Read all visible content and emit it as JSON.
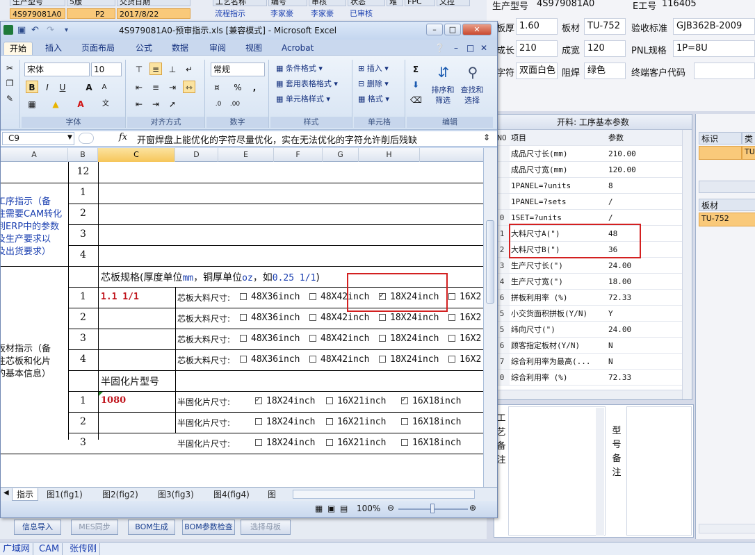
{
  "background_app": {
    "top_table": {
      "headers": [
        "生产型号",
        "5版",
        "交货日期"
      ],
      "row": {
        "model": "4S979081A0",
        "ver": "P2",
        "date": "2017/8/22"
      },
      "flow_headers": [
        "工艺名称",
        "编号",
        "审核",
        "状态",
        "难",
        "FPC",
        "文控"
      ],
      "flow_row": {
        "name": "流程指示",
        "no": "李家豪",
        "audit": "李家豪",
        "state": "已审核"
      }
    },
    "right_header": {
      "model_label": "生产型号",
      "model_value": "4S979081A0",
      "eno_label": "E工号",
      "eno_value": "116405",
      "thick_label": "板厚",
      "thick_value": "1.60",
      "mat_label": "板材",
      "mat_value": "TU-752",
      "std_label": "验收标准",
      "std_value": "GJB362B-2009",
      "len_label": "成长",
      "len_value": "210",
      "wid_label": "成宽",
      "wid_value": "120",
      "pnl_label": "PNL规格",
      "pnl_value": "1P=8U",
      "char_label": "字符",
      "char_value": "双面白色",
      "mask_label": "阻焊",
      "mask_value": "绿色",
      "cust_label": "终端客户代码"
    },
    "param_panel": {
      "title": "开料: 工序基本参数",
      "col_no": "NO",
      "col_item": "项目",
      "col_param": "参数",
      "rows": [
        {
          "no": "",
          "name": "成品尺寸长(mm)",
          "value": "210.00"
        },
        {
          "no": "",
          "name": "成品尺寸宽(mm)",
          "value": "120.00"
        },
        {
          "no": "",
          "name": "1PANEL=?units",
          "value": "8"
        },
        {
          "no": "",
          "name": "1PANEL=?sets",
          "value": "/"
        },
        {
          "no": "0",
          "name": "1SET=?units",
          "value": "/"
        },
        {
          "no": "1",
          "name": "大料尺寸A(\")",
          "value": "48"
        },
        {
          "no": "2",
          "name": "大料尺寸B(\")",
          "value": "36"
        },
        {
          "no": "3",
          "name": "生产尺寸长(\")",
          "value": "24.00"
        },
        {
          "no": "4",
          "name": "生产尺寸宽(\")",
          "value": "18.00"
        },
        {
          "no": "6",
          "name": "拼板利用率 (%)",
          "value": "72.33"
        },
        {
          "no": "5",
          "name": "小交货面积拼板(Y/N)",
          "value": "Y"
        },
        {
          "no": "5",
          "name": "纬向尺寸(\")",
          "value": "24.00"
        },
        {
          "no": "6",
          "name": "顾客指定板材(Y/N)",
          "value": "N"
        },
        {
          "no": "7",
          "name": "综合利用率为最高(...",
          "value": "N"
        },
        {
          "no": "0",
          "name": "综合利用率 (%)",
          "value": "72.33"
        }
      ]
    },
    "remark": {
      "left_vertical": "工艺备注",
      "right_vertical": "型号备注"
    },
    "right_col": {
      "ident": "标识",
      "type": "类",
      "row_val": "TU-",
      "mat_header": "板材",
      "mat_value": "TU-752"
    },
    "bottom_buttons": [
      "信息导入",
      "MES同步",
      "BOM生成",
      "BOM参数检查",
      "选择母板"
    ],
    "taskbar": [
      "广域网",
      "CAM",
      "张传刚"
    ]
  },
  "excel": {
    "title": "4S979081A0-预审指示.xls  [兼容模式] - Microsoft Excel",
    "tabs": [
      "开始",
      "插入",
      "页面布局",
      "公式",
      "数据",
      "审阅",
      "视图",
      "Acrobat"
    ],
    "font_name": "宋体",
    "font_size": "10",
    "number_format": "常规",
    "groups": {
      "font": "字体",
      "align": "对齐方式",
      "number": "数字",
      "style": "样式",
      "cells": "单元格",
      "edit": "编辑"
    },
    "style_buttons": [
      "条件格式",
      "套用表格格式",
      "单元格样式"
    ],
    "cell_buttons": [
      "插入",
      "删除",
      "格式"
    ],
    "edit_buttons": [
      "排序和筛选",
      "查找和选择"
    ],
    "name_box": "C9",
    "formula": "开窗焊盘上能优化的字符尽量优化，实在无法优化的字符允许削后残缺",
    "columns": [
      "A",
      "B",
      "C",
      "D",
      "E",
      "F",
      "G",
      "H"
    ],
    "section1_label": "工序指示（备注需要CAM转化到ERP中的参数及生产要求以及出货要求）",
    "section1_lines": [
      "工序指示（备",
      "注需要CAM转化",
      "到ERP中的参数",
      "及生产要求以",
      "及出货要求）"
    ],
    "section1_rows": [
      "12",
      "1",
      "2",
      "3",
      "4"
    ],
    "core_header": "芯板规格(厚度单位mm，铜厚单位oz，如0.25 1/1)",
    "core_header_parts": [
      "芯板规格(厚度单位",
      "mm",
      "，铜厚单位",
      "oz",
      "，如",
      "0.25 1/1",
      ")"
    ],
    "section2_lines": [
      "板材指示（备",
      "注芯板和化片",
      "的基本信息）"
    ],
    "core_rows": [
      {
        "no": "1",
        "spec": "1.1  1/1",
        "label": "芯板大料尺寸:",
        "opts": [
          "48X36inch",
          "48X42inch",
          "18X24inch",
          "16X2"
        ],
        "checked": [
          false,
          false,
          true,
          false
        ]
      },
      {
        "no": "2",
        "spec": "",
        "label": "芯板大料尺寸:",
        "opts": [
          "48X36inch",
          "48X42inch",
          "18X24inch",
          "16X2"
        ],
        "checked": [
          false,
          false,
          false,
          false
        ]
      },
      {
        "no": "3",
        "spec": "",
        "label": "芯板大料尺寸:",
        "opts": [
          "48X36inch",
          "48X42inch",
          "18X24inch",
          "16X2"
        ],
        "checked": [
          false,
          false,
          false,
          false
        ]
      },
      {
        "no": "4",
        "spec": "",
        "label": "芯板大料尺寸:",
        "opts": [
          "48X36inch",
          "48X42inch",
          "18X24inch",
          "16X2"
        ],
        "checked": [
          false,
          false,
          false,
          false
        ]
      }
    ],
    "prepreg_header": "半固化片型号",
    "prepreg_rows": [
      {
        "no": "1",
        "spec": "1080",
        "label": "半固化片尺寸:",
        "opts": [
          "18X24inch",
          "16X21inch",
          "16X18inch"
        ],
        "checked": [
          true,
          false,
          true
        ]
      },
      {
        "no": "2",
        "spec": "",
        "label": "半固化片尺寸:",
        "opts": [
          "18X24inch",
          "16X21inch",
          "16X18inch"
        ],
        "checked": [
          false,
          false,
          false
        ]
      },
      {
        "no": "3",
        "spec": "",
        "label": "半固化片尺寸:",
        "opts": [
          "18X24inch",
          "16X21inch",
          "16X18inch"
        ],
        "checked": [
          false,
          false,
          false
        ]
      }
    ],
    "sheet_tabs": [
      "指示",
      "图1(fig1)",
      "图2(fig2)",
      "图3(fig3)",
      "图4(fig4)",
      "图"
    ],
    "zoom": "100%",
    "colors": {
      "red_text": "#c0141c",
      "blue_text": "#1a3fb0",
      "highlight": "#d32020"
    }
  }
}
